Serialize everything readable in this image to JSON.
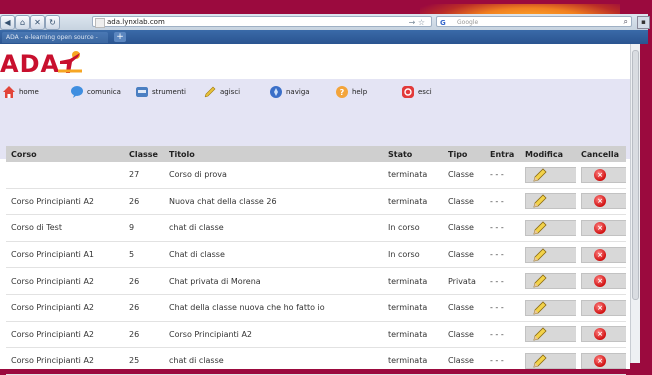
{
  "browser": {
    "url": "ada.lynxlab.com",
    "search_placeholder": "Google",
    "tab_title": "ADA - e-learning open source - Home",
    "new_tab": "+"
  },
  "logo": {
    "text": "ADA"
  },
  "menu": [
    {
      "label": "home",
      "icon": "home-icon",
      "color": "#e2443a"
    },
    {
      "label": "comunica",
      "icon": "bubble-icon",
      "color": "#3f8ee0"
    },
    {
      "label": "strumenti",
      "icon": "tools-icon",
      "color": "#4b7fc2"
    },
    {
      "label": "agisci",
      "icon": "pencil-icon",
      "color": "#e8c23a"
    },
    {
      "label": "naviga",
      "icon": "compass-icon",
      "color": "#3b6fc8"
    },
    {
      "label": "help",
      "icon": "question-icon",
      "color": "#f3a43a"
    },
    {
      "label": "esci",
      "icon": "exit-icon",
      "color": "#e23a3a"
    }
  ],
  "table": {
    "headers": [
      "Corso",
      "Classe",
      "Titolo",
      "Stato",
      "Tipo",
      "Entra",
      "Modifica",
      "Cancella"
    ],
    "rows": [
      {
        "corso": "",
        "classe": "27",
        "titolo": "Corso di prova",
        "stato": "terminata",
        "tipo": "Classe",
        "entra": "- - -"
      },
      {
        "corso": "Corso Principianti A2",
        "classe": "26",
        "titolo": "Nuova chat della classe 26",
        "stato": "terminata",
        "tipo": "Classe",
        "entra": "- - -"
      },
      {
        "corso": "Corso di Test",
        "classe": "9",
        "titolo": "chat di classe",
        "stato": "In corso",
        "tipo": "Classe",
        "entra": "- - -"
      },
      {
        "corso": "Corso Principianti A1",
        "classe": "5",
        "titolo": "Chat di classe",
        "stato": "In corso",
        "tipo": "Classe",
        "entra": "- - -"
      },
      {
        "corso": "Corso Principianti A2",
        "classe": "26",
        "titolo": "Chat privata di Morena",
        "stato": "terminata",
        "tipo": "Privata",
        "entra": "- - -"
      },
      {
        "corso": "Corso Principianti A2",
        "classe": "26",
        "titolo": "Chat della classe nuova che ho fatto io",
        "stato": "terminata",
        "tipo": "Classe",
        "entra": "- - -"
      },
      {
        "corso": "Corso Principianti A2",
        "classe": "26",
        "titolo": "Corso Principianti A2",
        "stato": "terminata",
        "tipo": "Classe",
        "entra": "- - -"
      },
      {
        "corso": "Corso Principianti A2",
        "classe": "25",
        "titolo": "chat di classe",
        "stato": "terminata",
        "tipo": "Classe",
        "entra": "- - -"
      }
    ]
  },
  "colors": {
    "brand": "#c8102e",
    "menu_bg": "#e4e4f4",
    "header_bg": "#cfcfcf",
    "frame": "#9b0a3e"
  }
}
